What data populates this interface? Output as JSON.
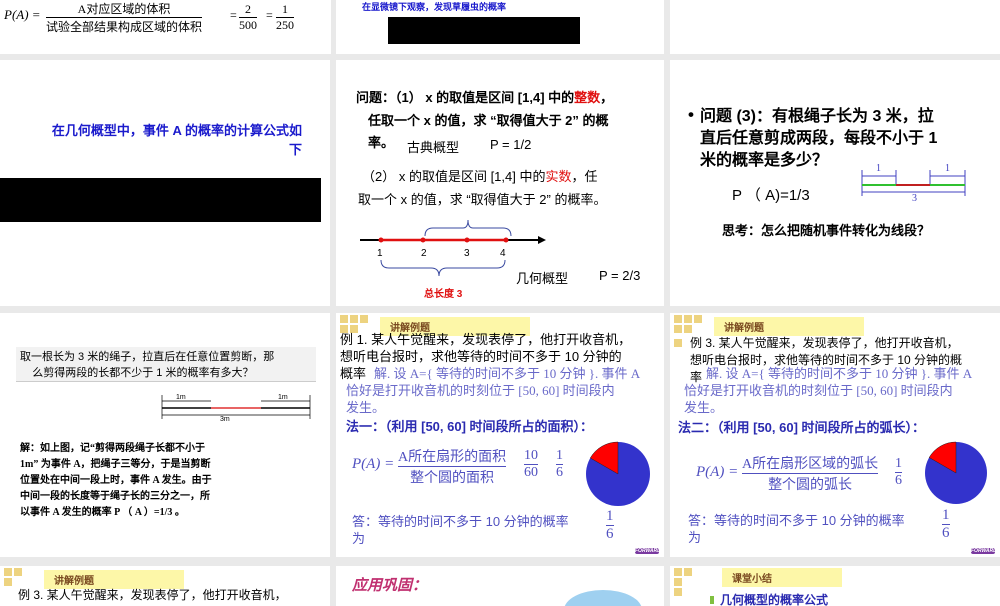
{
  "row1": {
    "slide1": {
      "lhs": "P(A) =",
      "numerator": "A对应区域的体积",
      "denominator": "试验全部结果构成区域的体积",
      "eq1": "=",
      "f1n": "2",
      "f1d": "500",
      "eq2": "=",
      "f2n": "1",
      "f2d": "250"
    },
    "slide2": {
      "text": "在显微镜下观察，发现草履虫的概率"
    }
  },
  "row2": {
    "slide1": {
      "line1": "在几何概型中，事件 A 的概率的计算公式如",
      "line2": "下"
    },
    "slide2": {
      "q1_a": "问题：（1） x 的取值是区间 [1,4] 中的",
      "q1_red": "整数",
      "q1_b": "，",
      "q1_line2": "任取一个 x 的值，求 “取得值大于 2” 的概",
      "q1_line3": "率。",
      "classic": "古典概型",
      "p1": "P = 1/2",
      "q2_a": "（2） x 的取值是区间 [1,4] 中的",
      "q2_red": "实数",
      "q2_b": "，任",
      "q2_line2": "取一个 x 的值，求 “取得值大于 2” 的概率。",
      "ticks": [
        "1",
        "2",
        "3",
        "4"
      ],
      "total": "总长度 3",
      "geo": "几何概型",
      "p2": "P = 2/3"
    },
    "slide3": {
      "bullet": "•",
      "line1": "问题 (3)：有根绳子长为 3 米，拉",
      "line2": "直后任意剪成两段，每段不小于 1",
      "line3": "米的概率是多少？",
      "p": "P （ A)=1/3",
      "seg_left": "1",
      "seg_right": "1",
      "seg_total": "3",
      "think": "思考：怎么把随机事件转化为线段？"
    }
  },
  "row3": {
    "slide1": {
      "q1": "取一根长为 3 米的绳子，拉直后在任意位置剪断，那",
      "q2": "么剪得两段的长都不少于 1 米的概率有多大？",
      "m1": "1m",
      "m2": "1m",
      "m3": "3m",
      "sol": [
        "解：如上图，记“剪得两段绳子长都不小于",
        "1m” 为事件 A，把绳子三等分，于是当剪断",
        "位置处在中间一段上时，事件 A 发生。由于",
        "中间一段的长度等于绳子长的三分之一，所",
        "以事件 A 发生的概率 P （ A ）=1/3 。"
      ]
    },
    "slide2": {
      "tag": "讲解例题",
      "ex1": "例 1. 某人午觉醒来，发现表停了，他打开收音机，",
      "ex2": "想听电台报时，求他等待的时间不多于 10 分钟的",
      "ex3": "概率",
      "sol1": "解. 设 A={ 等待的时间不多于 10 分钟 }. 事件 A",
      "sol2": "恰好是打开收音机的时刻位于 [50, 60] 时间段内",
      "sol3": "发生。",
      "method": "法一：（利用 [50, 60] 时间段所占的面积）：",
      "lhs": "P(A) =",
      "num": "A所在扇形的面积",
      "den": "整个圆的面积",
      "f1n": "10",
      "f1d": "60",
      "f2n": "1",
      "f2d": "6",
      "ans1": "答：等待的时间不多于 10 分钟的概率",
      "ans2": "为",
      "an": "1",
      "ad": "6",
      "fwd": "FORWARD"
    },
    "slide3": {
      "tag": "讲解例题",
      "ex1": "例 3. 某人午觉醒来，发现表停了，他打开收音机，",
      "ex2": "想听电台报时，求他等待的时间不多于 10 分钟的概",
      "ex3": "率",
      "sol1": "解. 设 A={ 等待的时间不多于 10 分钟 }. 事件 A",
      "sol2": "恰好是打开收音机的时刻位于 [50, 60] 时间段内",
      "sol3": "发生。",
      "method": "法二：（利用 [50, 60] 时间段所占的弧长）：",
      "lhs": "P(A) =",
      "num": "A所在扇形区域的弧长",
      "den": "整个圆的弧长",
      "f2n": "1",
      "f2d": "6",
      "ans1": "答：等待的时间不多于 10 分钟的概率",
      "ans2": "为",
      "an": "1",
      "ad": "6",
      "fwd": "FORWARD"
    }
  },
  "row4": {
    "slide1": {
      "tag": "讲解例题",
      "ex1": "例 3. 某人午觉醒来，发现表停了，他打开收音机，"
    },
    "slide2": {
      "title": "应用巩固："
    },
    "slide3": {
      "tag": "课堂小结",
      "item": "几何概型的概率公式"
    }
  },
  "colors": {
    "blue": "#1a1acc",
    "red": "#e01010",
    "pie_blue": "#3333cc",
    "pie_red": "#ff0000"
  }
}
